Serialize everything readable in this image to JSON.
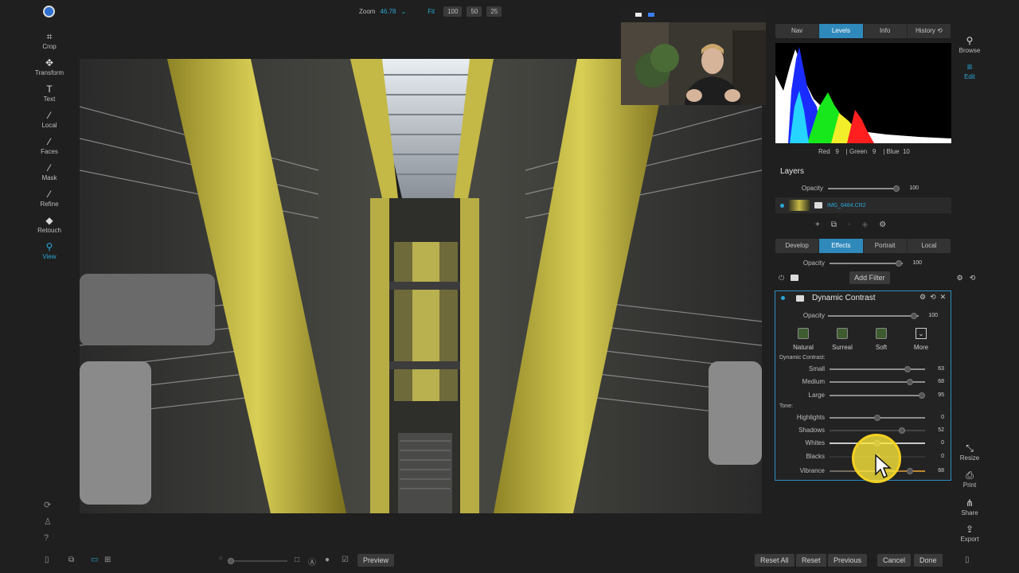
{
  "left_tools": [
    {
      "icon": "crop-icon",
      "glyph": "⌗",
      "label": "Crop"
    },
    {
      "icon": "transform-icon",
      "glyph": "✥",
      "label": "Transform"
    },
    {
      "icon": "text-icon",
      "glyph": "T",
      "label": "Text"
    },
    {
      "icon": "local-icon",
      "glyph": "⁄",
      "label": "Local"
    },
    {
      "icon": "faces-icon",
      "glyph": "⁄",
      "label": "Faces"
    },
    {
      "icon": "mask-icon",
      "glyph": "⁄",
      "label": "Mask"
    },
    {
      "icon": "refine-icon",
      "glyph": "⁄",
      "label": "Refine"
    },
    {
      "icon": "retouch-icon",
      "glyph": "◆",
      "label": "Retouch"
    },
    {
      "icon": "view-icon",
      "glyph": "⚲",
      "label": "View"
    }
  ],
  "zoom": {
    "label": "Zoom",
    "value": "46.78",
    "presets": [
      "Fit",
      "100",
      "50",
      "25"
    ]
  },
  "right_nav": {
    "browse": "Browse",
    "edit": "Edit",
    "resize": "Resize",
    "print": "Print",
    "share": "Share",
    "export": "Export"
  },
  "top_tabs": [
    "Nav",
    "Levels",
    "Info",
    "History ⟲"
  ],
  "top_tabs_active": "Levels",
  "rgb_readout": "Red   9    | Green   9    | Blue  10",
  "layers": {
    "title": "Layers",
    "opacity_label": "Opacity",
    "opacity_value": "100",
    "opacity_level": 0.95,
    "layer_name": "IMG_6484.CR2"
  },
  "edit_tabs": [
    "Develop",
    "Effects",
    "Portrait",
    "Local"
  ],
  "edit_tabs_active": "Effects",
  "effects": {
    "opacity_label": "Opacity",
    "opacity_value": "100",
    "opacity_level": 0.95,
    "add_filter": "Add Filter"
  },
  "dynamic_contrast": {
    "title": "Dynamic Contrast",
    "opacity_label": "Opacity",
    "opacity_value": "100",
    "opacity_level": 0.95,
    "presets": [
      "Natural",
      "Surreal",
      "Soft",
      "More"
    ],
    "section_label": "Dynamic Contrast:",
    "sliders": [
      {
        "label": "Small",
        "value": "63",
        "level": 0.82
      },
      {
        "label": "Medium",
        "value": "68",
        "level": 0.84
      },
      {
        "label": "Large",
        "value": "95",
        "level": 0.97
      }
    ],
    "tone_label": "Tone:",
    "tone_sliders": [
      {
        "label": "Highlights",
        "value": "0",
        "level": 0.5
      },
      {
        "label": "Shadows",
        "value": "52",
        "level": 0.76
      },
      {
        "label": "Whites",
        "value": "0",
        "level": 0.5
      },
      {
        "label": "Blacks",
        "value": "0",
        "level": 0.5
      },
      {
        "label": "Vibrance",
        "value": "68",
        "level": 0.84
      }
    ]
  },
  "bottom": {
    "preview": "Preview",
    "reset_all": "Reset All",
    "reset": "Reset",
    "previous": "Previous",
    "cancel": "Cancel",
    "done": "Done"
  },
  "colors": {
    "accent": "#2aa7d8",
    "tab_active": "#2f89bb",
    "cursor_highlight": "#f4d020"
  }
}
